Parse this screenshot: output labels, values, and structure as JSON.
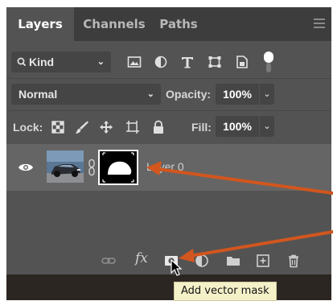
{
  "tabs": [
    {
      "label": "Layers",
      "active": true
    },
    {
      "label": "Channels",
      "active": false
    },
    {
      "label": "Paths",
      "active": false
    }
  ],
  "filter": {
    "kind_label": "Kind",
    "icons": [
      "image-filter-icon",
      "adjustment-filter-icon",
      "type-filter-icon",
      "shape-filter-icon",
      "smart-object-filter-icon"
    ],
    "toggle_on": true
  },
  "blend": {
    "mode": "Normal",
    "opacity_label": "Opacity:",
    "opacity_value": "100%"
  },
  "lock": {
    "label": "Lock:",
    "icons": [
      "lock-transparent-pixels-icon",
      "lock-image-pixels-icon",
      "lock-position-icon",
      "lock-artboard-icon",
      "lock-all-icon"
    ],
    "fill_label": "Fill:",
    "fill_value": "100%"
  },
  "layer": {
    "name": "Layer 0",
    "visible": true
  },
  "bottom": {
    "fx_label": "fx",
    "icons": [
      "link-layers-icon",
      "layer-style-icon",
      "add-mask-icon",
      "adjustment-layer-icon",
      "new-group-icon",
      "new-layer-icon",
      "delete-layer-icon"
    ]
  },
  "tooltip": "Add vector mask",
  "colors": {
    "panel_bg": "#535353",
    "tabbar_bg": "#3d3d3d",
    "selected_layer_bg": "#656565",
    "annotation_arrow": "#d2561e",
    "tooltip_bg": "#f4f1c9"
  }
}
